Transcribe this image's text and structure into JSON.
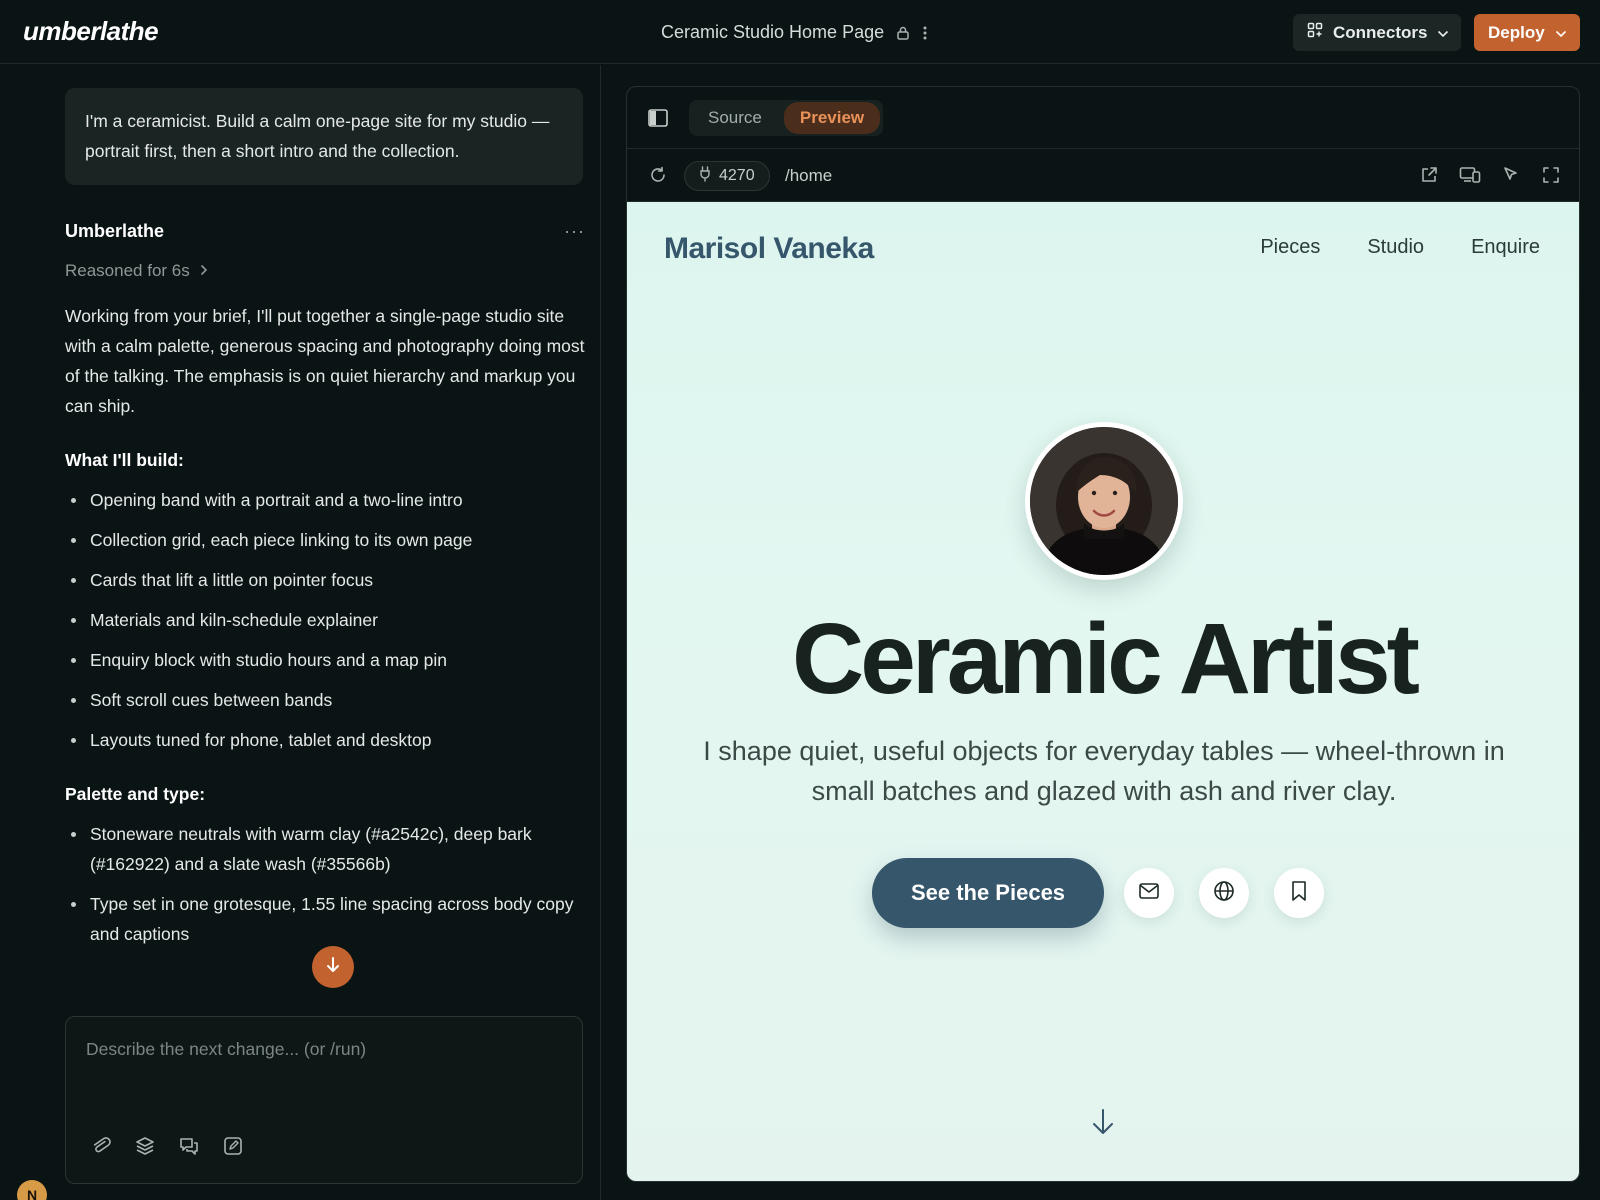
{
  "app": {
    "logo": "umberlathe",
    "project_title": "Ceramic Studio Home Page",
    "connectors_label": "Connectors",
    "deploy_label": "Deploy"
  },
  "chat": {
    "user_message": "I'm a ceramicist. Build a calm one-page site for my studio — portrait first, then a short intro and the collection.",
    "assistant_name": "Umberlathe",
    "reasoned": "Reasoned for 6s",
    "intro": "Working from your brief, I'll put together a single-page studio site with a calm palette, generous spacing and photography doing most of the talking. The emphasis is on quiet hierarchy and markup you can ship.",
    "build_heading": "What I'll build:",
    "build_items": [
      "Opening band with a portrait and a two-line intro",
      "Collection grid, each piece linking to its own page",
      "Cards that lift a little on pointer focus",
      "Materials and kiln-schedule explainer",
      "Enquiry block with studio hours and a map pin",
      "Soft scroll cues between bands",
      "Layouts tuned for phone, tablet and desktop"
    ],
    "palette_heading": "Palette and type:",
    "palette_items": [
      "Stoneware neutrals with warm clay (#a2542c), deep bark (#162922) and a slate wash (#35566b)",
      "Type set in one grotesque, 1.55 line spacing across body copy and captions"
    ],
    "composer_placeholder": "Describe the next change... (or /run)",
    "user_initial": "N"
  },
  "preview": {
    "tabs": [
      {
        "label": "Source",
        "active": false
      },
      {
        "label": "Preview",
        "active": true
      }
    ],
    "port": "4270",
    "path": "/home",
    "site": {
      "brand": "Marisol Vaneka",
      "nav": [
        "Pieces",
        "Studio",
        "Enquire"
      ],
      "title": "Ceramic Artist",
      "subtitle": "I shape quiet, useful objects for everyday tables — wheel-thrown in small batches and glazed with ash and river clay.",
      "cta": "See the Pieces"
    }
  },
  "colors": {
    "accent": "#c2632f",
    "clay": "#a2542c",
    "bark": "#162922",
    "slate": "#35566b",
    "background": "#0b1414",
    "site_mint": "#dcf5ee"
  },
  "icons": {
    "site_actions": [
      "mail-icon",
      "globe-icon",
      "bookmark-icon"
    ],
    "composer_tools": [
      "attach-icon",
      "layers-icon",
      "chat-icon",
      "edit-icon"
    ],
    "preview_actions": [
      "external-link-icon",
      "devices-icon",
      "pointer-icon",
      "fullscreen-icon"
    ]
  }
}
